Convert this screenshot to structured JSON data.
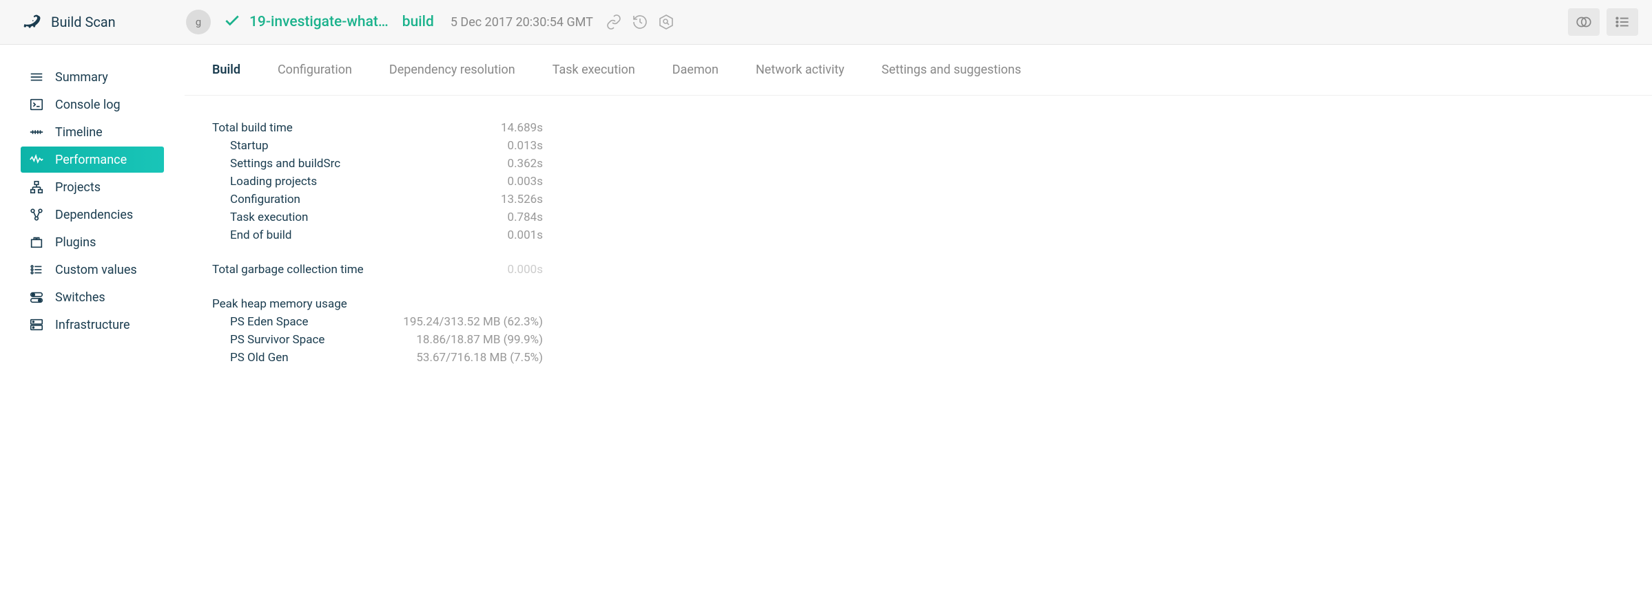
{
  "app_title": "Build Scan",
  "header": {
    "avatar_initial": "g",
    "branch_name": "19-investigate-what…",
    "task_name": "build",
    "timestamp": "5 Dec 2017 20:30:54 GMT"
  },
  "sidebar": {
    "items": [
      {
        "label": "Summary",
        "icon": "summary"
      },
      {
        "label": "Console log",
        "icon": "console"
      },
      {
        "label": "Timeline",
        "icon": "timeline"
      },
      {
        "label": "Performance",
        "icon": "performance",
        "active": true
      },
      {
        "label": "Projects",
        "icon": "projects"
      },
      {
        "label": "Dependencies",
        "icon": "dependencies"
      },
      {
        "label": "Plugins",
        "icon": "plugins"
      },
      {
        "label": "Custom values",
        "icon": "custom-values"
      },
      {
        "label": "Switches",
        "icon": "switches"
      },
      {
        "label": "Infrastructure",
        "icon": "infrastructure"
      }
    ]
  },
  "tabs": [
    {
      "label": "Build",
      "active": true
    },
    {
      "label": "Configuration"
    },
    {
      "label": "Dependency resolution"
    },
    {
      "label": "Task execution"
    },
    {
      "label": "Daemon"
    },
    {
      "label": "Network activity"
    },
    {
      "label": "Settings and suggestions"
    }
  ],
  "build_time": {
    "header_label": "Total build time",
    "header_value": "14.689s",
    "rows": [
      {
        "label": "Startup",
        "value": "0.013s"
      },
      {
        "label": "Settings and buildSrc",
        "value": "0.362s"
      },
      {
        "label": "Loading projects",
        "value": "0.003s"
      },
      {
        "label": "Configuration",
        "value": "13.526s"
      },
      {
        "label": "Task execution",
        "value": "0.784s"
      },
      {
        "label": "End of build",
        "value": "0.001s"
      }
    ]
  },
  "gc": {
    "label": "Total garbage collection time",
    "value": "0.000s"
  },
  "heap": {
    "header_label": "Peak heap memory usage",
    "rows": [
      {
        "label": "PS Eden Space",
        "value": "195.24/313.52 MB (62.3%)"
      },
      {
        "label": "PS Survivor Space",
        "value": "18.86/18.87 MB (99.9%)"
      },
      {
        "label": "PS Old Gen",
        "value": "53.67/716.18 MB (7.5%)"
      }
    ]
  }
}
